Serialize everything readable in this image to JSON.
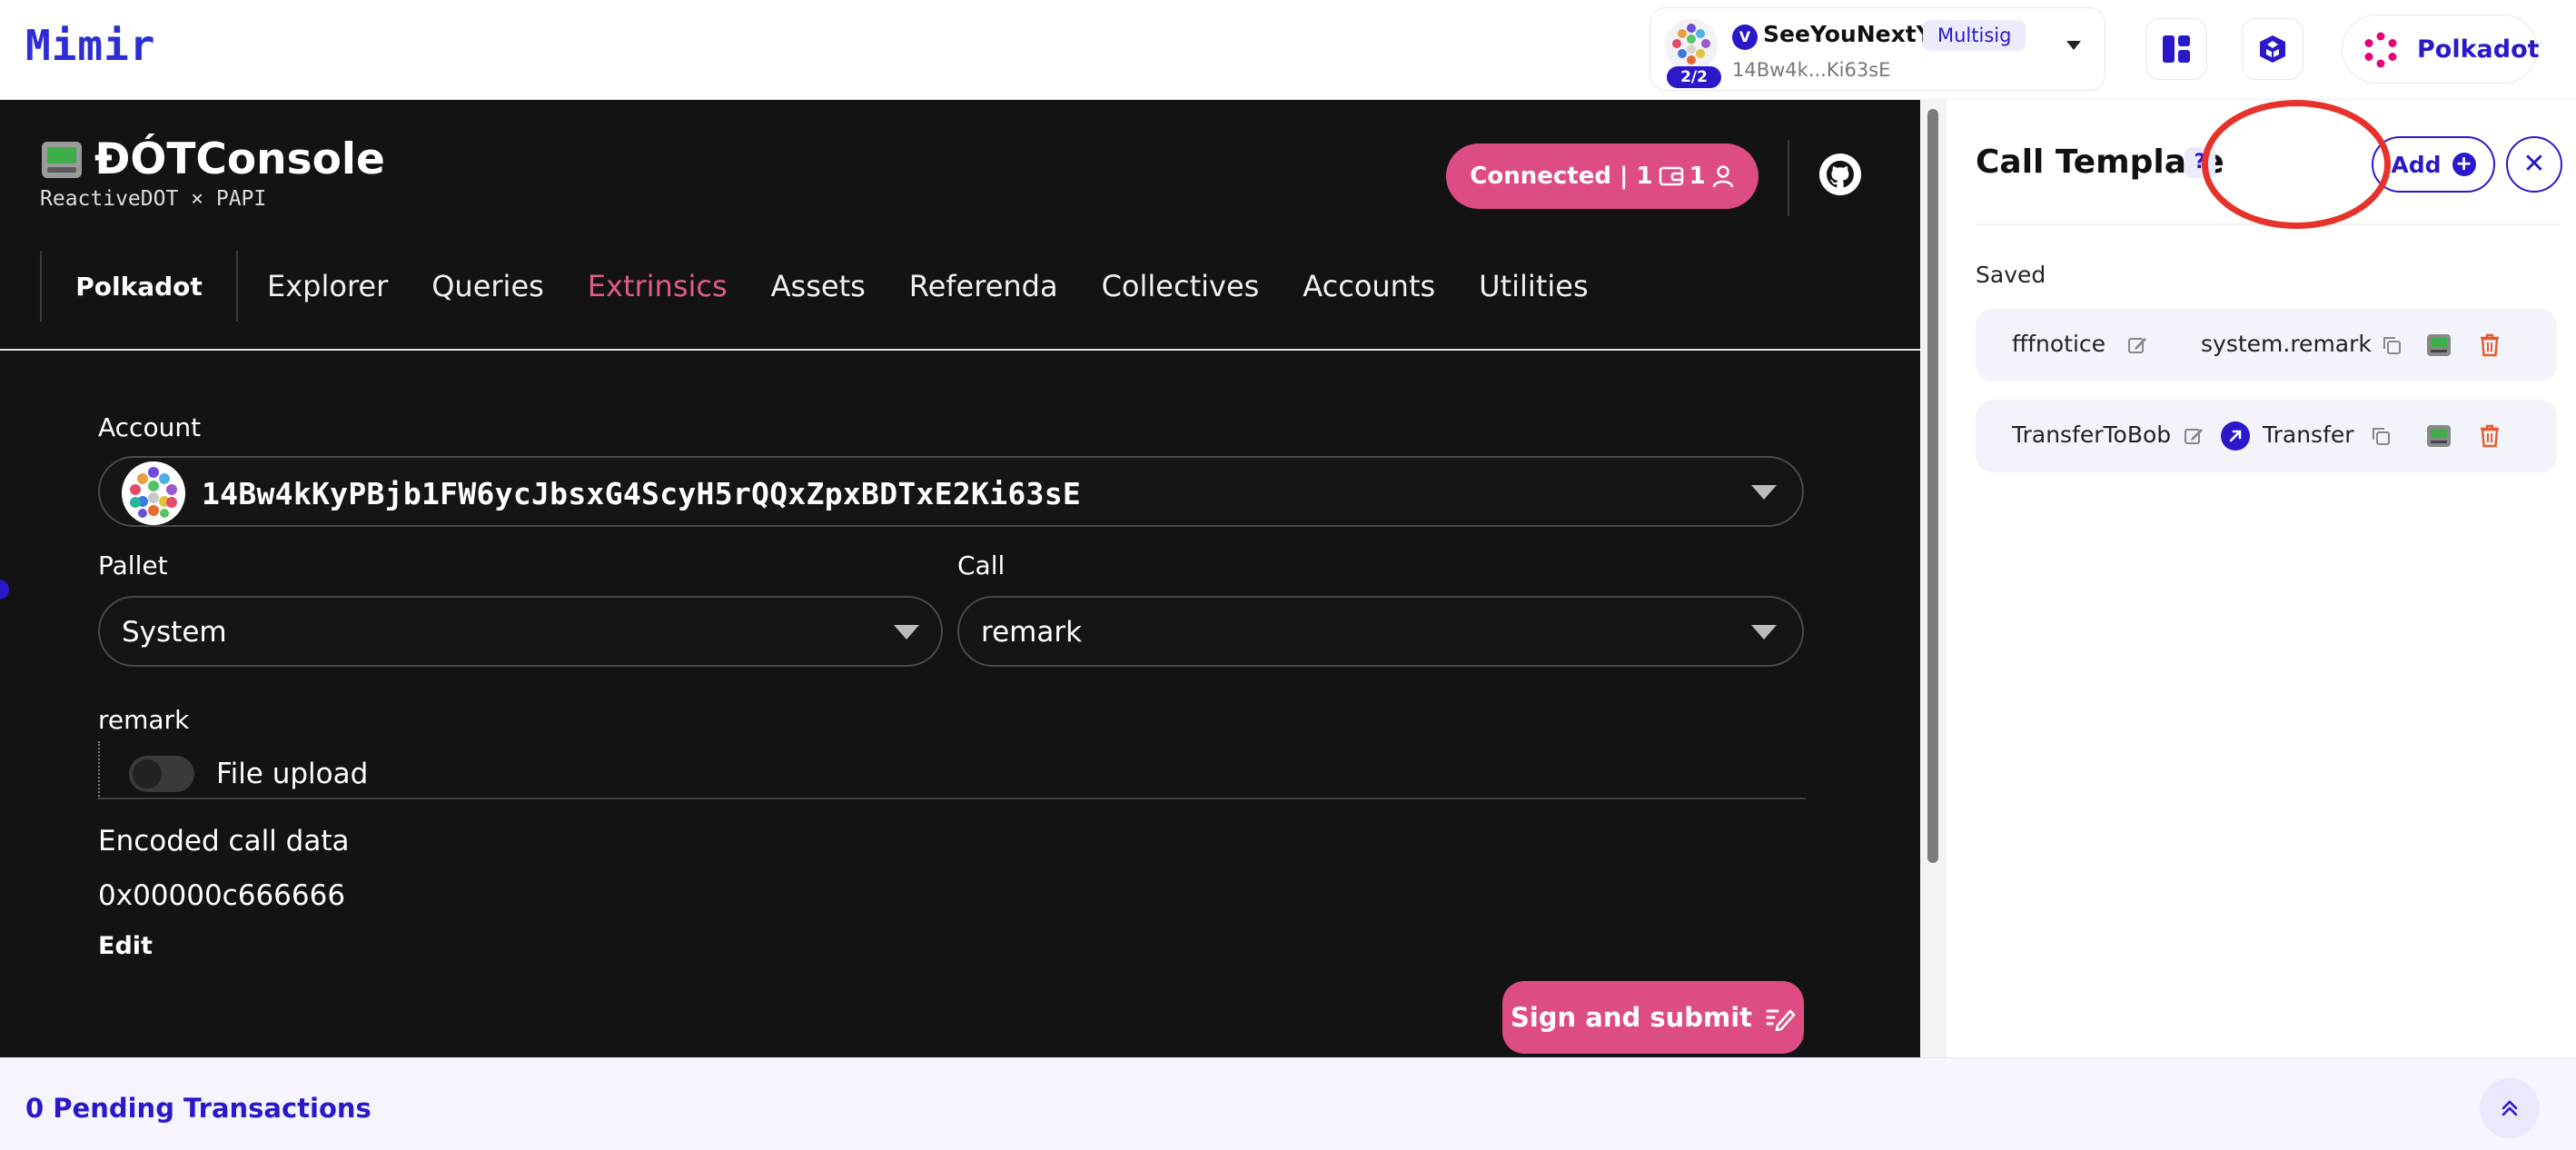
{
  "brand": {
    "name": "Mimir"
  },
  "account": {
    "name": "SeeYouNextYe",
    "badge": "Multisig",
    "short_address": "14Bw4k...Ki63sE",
    "threshold": "2/2",
    "verified_glyph": "V"
  },
  "network": {
    "label": "Polkadot"
  },
  "dapp": {
    "title": "ĐÓTConsole",
    "subtitle": "ReactiveDOT × PAPI",
    "connected_text": "Connected | 1",
    "connected_count": "1",
    "chain_tab": "Polkadot",
    "tabs": [
      "Explorer",
      "Queries",
      "Extrinsics",
      "Assets",
      "Referenda",
      "Collectives",
      "Accounts",
      "Utilities"
    ],
    "active_tab": "Extrinsics",
    "account_label": "Account",
    "account_value": "14Bw4kKyPBjb1FW6ycJbsxG4ScyH5rQQxZpxBDTxE2Ki63sE",
    "pallet_label": "Pallet",
    "pallet_value": "System",
    "call_label": "Call",
    "call_value": "remark",
    "param_label": "remark",
    "file_upload_label": "File upload",
    "encoded_label": "Encoded call data",
    "encoded_value": "0x00000c666666",
    "edit_label": "Edit",
    "sign_label": "Sign and submit"
  },
  "panel": {
    "title": "Call Template",
    "help": "?",
    "add_label": "Add",
    "close_glyph": "✕",
    "saved_label": "Saved",
    "templates": [
      {
        "name": "fffnotice",
        "call": "system.remark"
      },
      {
        "name": "TransferToBob",
        "call": "Transfer"
      }
    ]
  },
  "bottom": {
    "pending": "0 Pending Transactions"
  },
  "colors": {
    "accent": "#2a18c9",
    "pink": "#dd4c82",
    "dark": "#131313",
    "danger": "#e6322a"
  },
  "icons": [
    "dashboard-icon",
    "app-store-icon",
    "polkadot-icon",
    "github-icon",
    "wallet-icon",
    "user-icon",
    "pen-icon",
    "edit-icon",
    "copy-icon",
    "console-icon",
    "trash-icon",
    "arrow-up-right-icon",
    "chevron-double-up-icon"
  ]
}
